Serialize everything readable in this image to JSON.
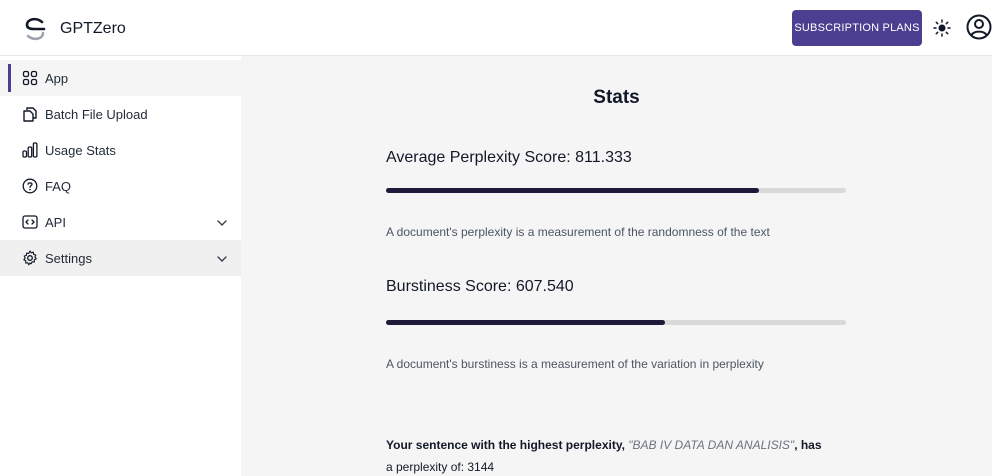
{
  "header": {
    "brand_name": "GPTZero",
    "subscription_label": "SUBSCRIPTION PLANS",
    "theme_icon": "sun-icon",
    "profile_icon": "user-circle-icon",
    "accent_color": "#4c3f91"
  },
  "sidebar": {
    "items": [
      {
        "label": "App",
        "icon": "grid-icon",
        "active": true
      },
      {
        "label": "Batch File Upload",
        "icon": "files-icon"
      },
      {
        "label": "Usage Stats",
        "icon": "bar-chart-icon"
      },
      {
        "label": "FAQ",
        "icon": "question-circle-icon"
      },
      {
        "label": "API",
        "icon": "code-icon",
        "expandable": true
      },
      {
        "label": "Settings",
        "icon": "gear-icon",
        "expandable": true
      }
    ]
  },
  "stats": {
    "title": "Stats",
    "perplexity": {
      "label": "Average Perplexity Score: 811.333",
      "bar_fraction": 0.81,
      "description": "A document's perplexity is a measurement of the randomness of the text"
    },
    "burstiness": {
      "label": "Burstiness Score: 607.540",
      "bar_fraction": 0.607,
      "description": "A document's burstiness is a measurement of the variation in perplexity"
    },
    "highest": {
      "prefix": "Your sentence with the highest perplexity, ",
      "sentence": "\"BAB IV DATA DAN ANALISIS\"",
      "middle": ", has",
      "suffix": "a perplexity of: ",
      "value": "3144"
    }
  }
}
